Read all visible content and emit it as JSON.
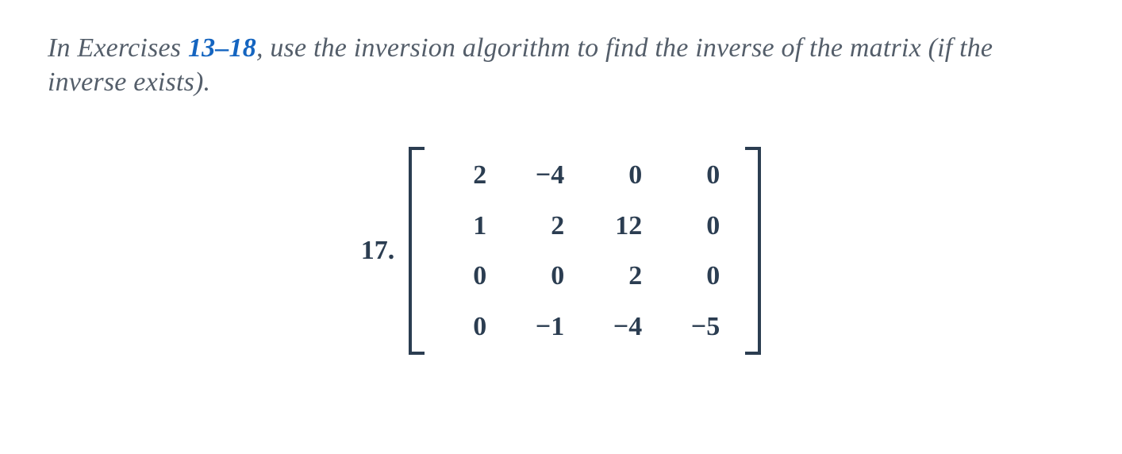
{
  "instruction": {
    "prefix": "In Exercises ",
    "range": "13–18",
    "suffix": ", use the inversion algorithm to find the inverse of the matrix (if the inverse exists)."
  },
  "problem": {
    "number": "17.",
    "matrix": [
      [
        "2",
        "−4",
        "0",
        "0"
      ],
      [
        "1",
        "2",
        "12",
        "0"
      ],
      [
        "0",
        "0",
        "2",
        "0"
      ],
      [
        "0",
        "−1",
        "−4",
        "−5"
      ]
    ]
  }
}
